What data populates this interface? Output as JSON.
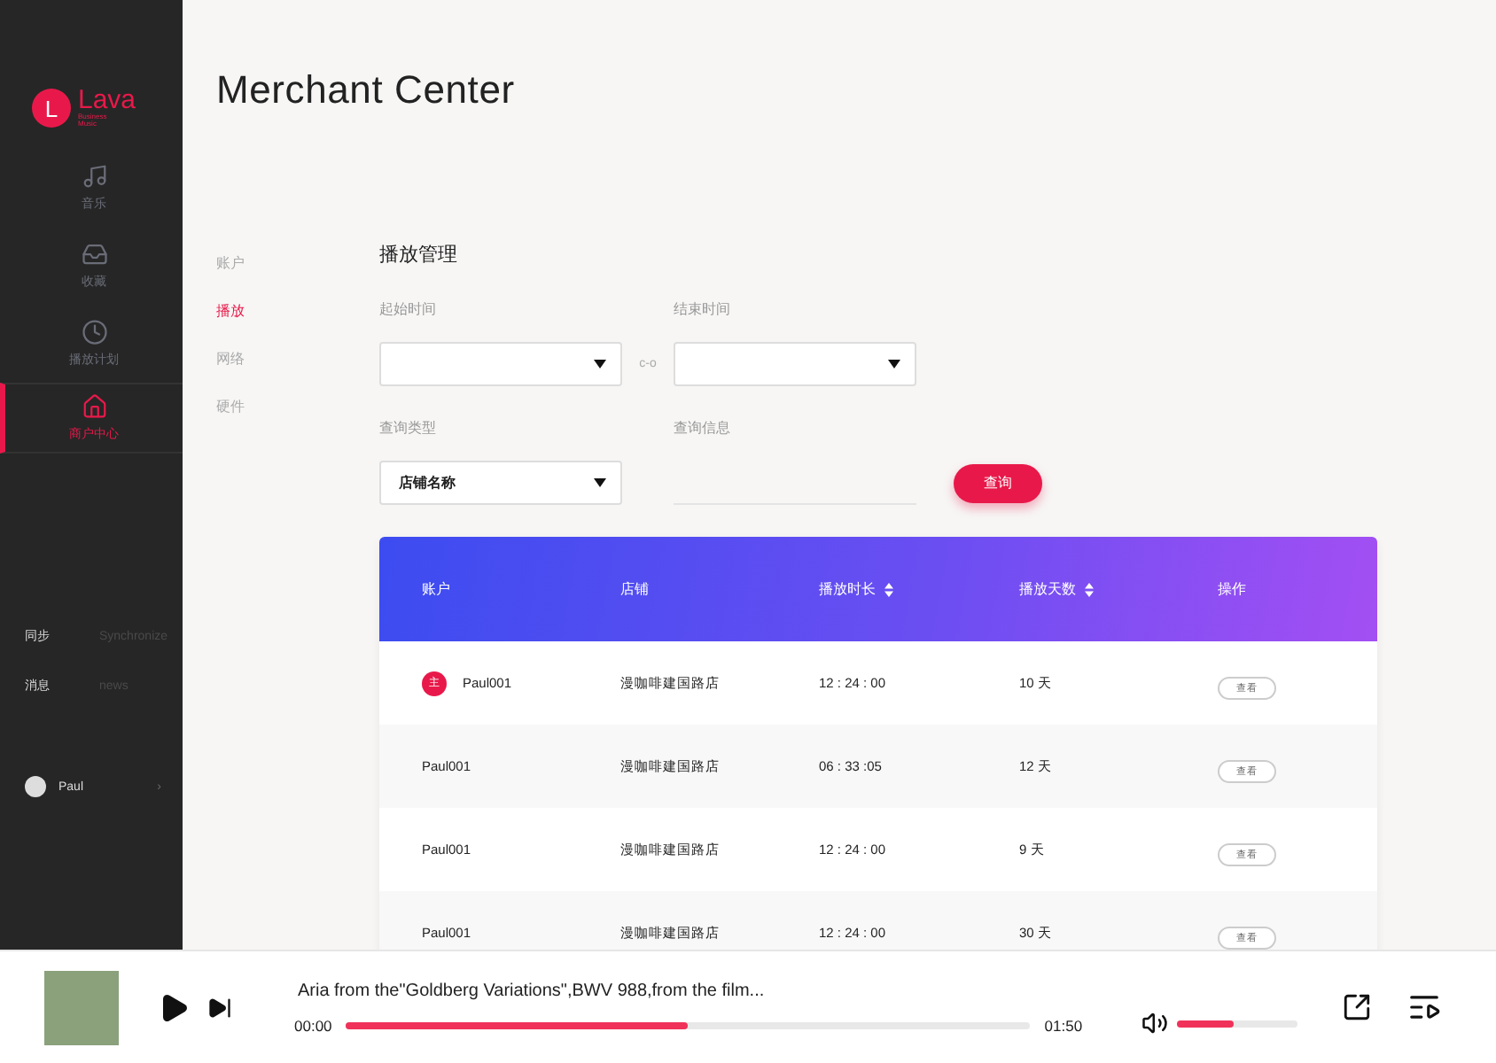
{
  "logo": {
    "letter": "L",
    "name": "Lava",
    "tagline": [
      "Business",
      "Music"
    ]
  },
  "sidebar": {
    "items": [
      {
        "label": "音乐",
        "selected": false
      },
      {
        "label": "收藏",
        "selected": false
      },
      {
        "label": "播放计划",
        "selected": false
      },
      {
        "label": "商户中心",
        "selected": true
      }
    ],
    "links": [
      {
        "label": "同步",
        "hint": "Synchronize"
      },
      {
        "label": "消息",
        "hint": "news"
      }
    ],
    "user": {
      "name": "Paul",
      "chevron": "›"
    }
  },
  "page_title": "Merchant Center",
  "subnav": [
    {
      "label": "账户",
      "selected": false
    },
    {
      "label": "播放",
      "selected": true
    },
    {
      "label": "网络",
      "selected": false
    },
    {
      "label": "硬件",
      "selected": false
    }
  ],
  "section_title": "播放管理",
  "filters": {
    "start_label": "起始时间",
    "separator": "c-o",
    "end_label": "结束时间",
    "type_label": "查询类型",
    "type_value": "店铺名称",
    "info_label": "查询信息",
    "button": "查询"
  },
  "table": {
    "columns": [
      {
        "label": "账户",
        "sortable": false
      },
      {
        "label": "店铺",
        "sortable": false
      },
      {
        "label": "播放时长",
        "sortable": true
      },
      {
        "label": "播放天数",
        "sortable": true
      },
      {
        "label": "操作",
        "sortable": false
      }
    ],
    "rows": [
      {
        "badge": "主",
        "account": "Paul001",
        "store": "漫咖啡建国路店",
        "duration": "12 : 24 : 00",
        "days": "10 天",
        "action": "查看"
      },
      {
        "account": "Paul001",
        "store": "漫咖啡建国路店",
        "duration": "06 : 33 :05",
        "days": "12 天",
        "action": "查看"
      },
      {
        "account": "Paul001",
        "store": "漫咖啡建国路店",
        "duration": "12 : 24 : 00",
        "days": "9 天",
        "action": "查看"
      },
      {
        "account": "Paul001",
        "store": "漫咖啡建国路店",
        "duration": "12 : 24 : 00",
        "days": "30 天",
        "action": "查看"
      }
    ]
  },
  "player": {
    "title": "Aria from the\"Goldberg Variations\",BWV 988,from the film...",
    "elapsed": "00:00",
    "total": "01:50",
    "level": 0.5,
    "volume": {
      "level": 0.47
    }
  }
}
